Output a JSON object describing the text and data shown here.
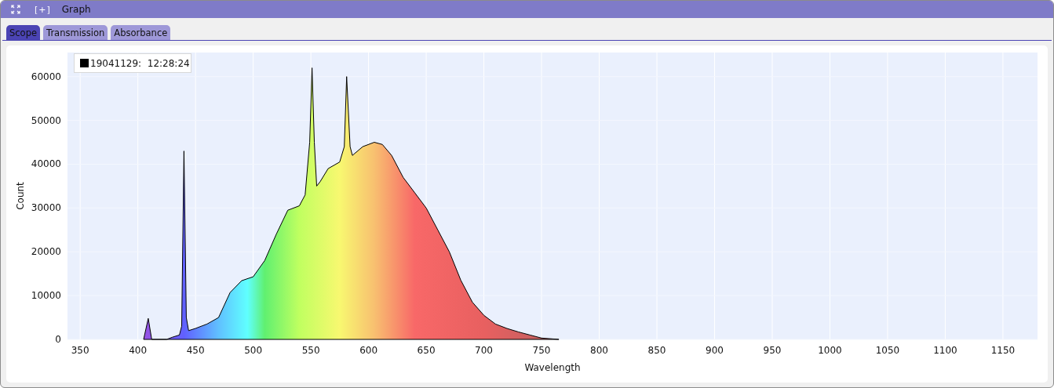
{
  "window": {
    "title": "Graph",
    "expand_label": "[+]"
  },
  "tabs": [
    {
      "label": "Scope",
      "selected": true
    },
    {
      "label": "Transmission",
      "selected": false
    },
    {
      "label": "Absorbance",
      "selected": false
    }
  ],
  "chart_data": {
    "type": "area",
    "grid": true,
    "xlabel": "Wavelength",
    "ylabel": "Count",
    "xlim": [
      339,
      1180
    ],
    "ylim": [
      0,
      65500
    ],
    "xticks": [
      350,
      400,
      450,
      500,
      550,
      600,
      650,
      700,
      750,
      800,
      850,
      900,
      950,
      1000,
      1050,
      1100,
      1150
    ],
    "yticks": [
      0,
      10000,
      20000,
      30000,
      40000,
      50000,
      60000
    ],
    "x": [
      405,
      409,
      412,
      425,
      430,
      436,
      438,
      440,
      442,
      444,
      450,
      460,
      470,
      480,
      490,
      500,
      510,
      520,
      530,
      540,
      545,
      549,
      551,
      553,
      555,
      558,
      565,
      575,
      579,
      581,
      584,
      586,
      595,
      605,
      612,
      620,
      630,
      640,
      650,
      660,
      670,
      680,
      690,
      700,
      710,
      720,
      730,
      740,
      750,
      760,
      765
    ],
    "series": [
      {
        "name": "19041129:  12:28:24",
        "color": "#000000",
        "values": [
          0,
          4800,
          0,
          0,
          500,
          1000,
          3000,
          43000,
          5000,
          2000,
          2500,
          3500,
          5000,
          10700,
          13400,
          14300,
          18000,
          24000,
          29500,
          30500,
          33000,
          45000,
          62000,
          45000,
          35000,
          36000,
          39000,
          40500,
          44000,
          60000,
          44000,
          42000,
          44000,
          45000,
          44500,
          42000,
          37000,
          33500,
          30000,
          25000,
          20000,
          13500,
          8500,
          5500,
          3500,
          2500,
          1700,
          1000,
          300,
          100,
          0
        ]
      }
    ]
  }
}
